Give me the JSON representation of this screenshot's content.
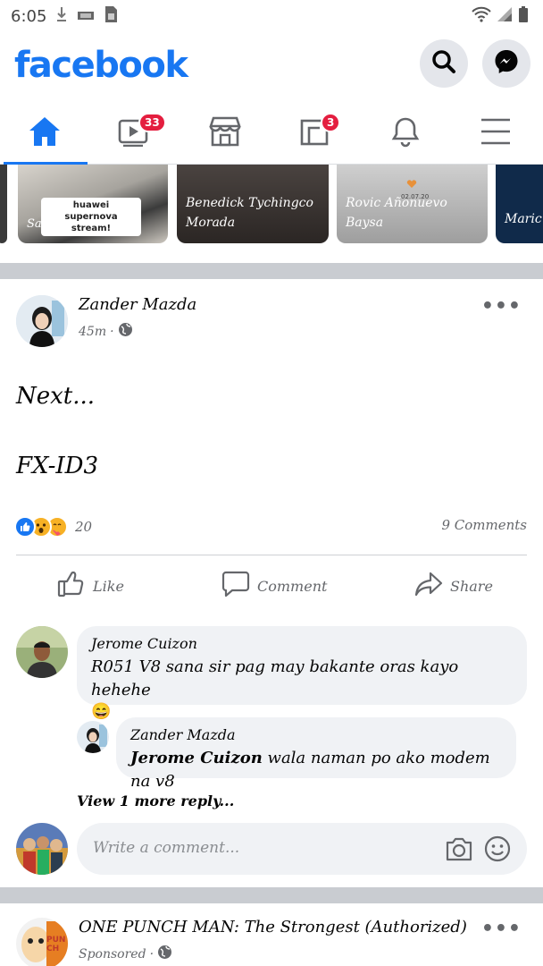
{
  "status_bar": {
    "time": "6:05"
  },
  "app": {
    "logo": "facebook"
  },
  "tabs": [
    {
      "name": "home",
      "active": true
    },
    {
      "name": "watch",
      "badge": "33"
    },
    {
      "name": "marketplace"
    },
    {
      "name": "pages",
      "badge": "3"
    },
    {
      "name": "notifications"
    },
    {
      "name": "menu"
    }
  ],
  "stories": [
    {
      "name": "Samu",
      "tag": "huawei supernova stream!"
    },
    {
      "name": "Benedick Tychingco Morada"
    },
    {
      "name": "Rovic Añonuevo Baysa",
      "date_tag": "02.07.20"
    },
    {
      "name": "Maric"
    }
  ],
  "post": {
    "author": "Zander Mazda",
    "time": "45m",
    "line1": "Next...",
    "line2": "FX-ID3",
    "reaction_count": "20",
    "comments_count": "9 Comments",
    "actions": {
      "like": "Like",
      "comment": "Comment",
      "share": "Share"
    }
  },
  "comments": [
    {
      "author": "Jerome Cuizon",
      "text": "R051 V8 sana sir pag may bakante oras kayo hehehe",
      "emoji": "😄"
    },
    {
      "author": "Zander Mazda",
      "mention": "Jerome Cuizon",
      "text": "wala naman po ako modem na v8"
    }
  ],
  "view_more": "View 1 more reply...",
  "comment_input": {
    "placeholder": "Write a comment..."
  },
  "sponsored": {
    "name": "ONE PUNCH MAN: The Strongest (Authorized)",
    "label": "Sponsored",
    "thumb_text": "PUNCH"
  },
  "colors": {
    "brand": "#1877f2",
    "badge": "#e41e3f",
    "divider": "#c9ccd1"
  }
}
